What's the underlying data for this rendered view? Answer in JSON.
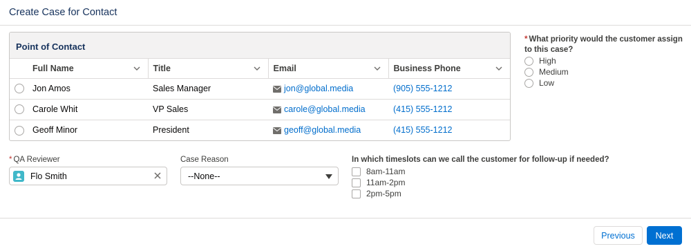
{
  "header": {
    "title": "Create Case for Contact"
  },
  "contacts_table": {
    "title": "Point of Contact",
    "columns": [
      "Full Name",
      "Title",
      "Email",
      "Business Phone"
    ],
    "rows": [
      {
        "name": "Jon Amos",
        "title": "Sales Manager",
        "email": "jon@global.media",
        "phone": "(905) 555-1212"
      },
      {
        "name": "Carole Whit",
        "title": "VP Sales",
        "email": "carole@global.media",
        "phone": "(415) 555-1212"
      },
      {
        "name": "Geoff Minor",
        "title": "President",
        "email": "geoff@global.media",
        "phone": "(415) 555-1212"
      }
    ]
  },
  "priority": {
    "required_mark": "*",
    "question": "What priority would the customer assign to this case?",
    "options": [
      "High",
      "Medium",
      "Low"
    ]
  },
  "qa_reviewer": {
    "required_mark": "*",
    "label": "QA Reviewer",
    "value": "Flo Smith"
  },
  "case_reason": {
    "label": "Case Reason",
    "selected": "--None--"
  },
  "timeslots": {
    "question": "In which timeslots can we call the customer for follow-up if needed?",
    "options": [
      "8am-11am",
      "11am-2pm",
      "2pm-5pm"
    ]
  },
  "footer": {
    "previous_label": "Previous",
    "next_label": "Next"
  },
  "colors": {
    "brand": "#0070d2",
    "link": "#006dcc",
    "required": "#c23934",
    "avatar": "#40b8c9"
  }
}
